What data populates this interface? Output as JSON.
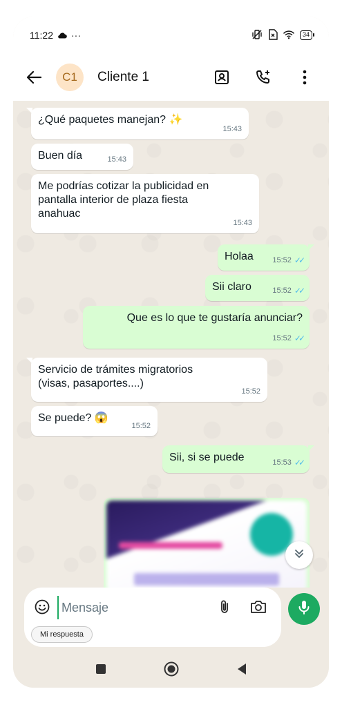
{
  "status_bar": {
    "time": "11:22",
    "notif_icon": "cloud-icon",
    "more_dots": "···",
    "battery": "34",
    "icons": [
      "vibrate-off-icon",
      "sim-x-icon",
      "wifi-icon",
      "battery-icon"
    ]
  },
  "header": {
    "avatar_initials": "C1",
    "contact_name": "Cliente 1",
    "icons": [
      "back-arrow-icon",
      "contact-card-icon",
      "add-call-icon",
      "more-vert-icon"
    ]
  },
  "messages": [
    {
      "dir": "in",
      "text": "¿Qué paquetes manejan? ✨",
      "time": "15:43"
    },
    {
      "dir": "in",
      "text": "Buen día",
      "time": "15:43"
    },
    {
      "dir": "in",
      "text": "Me podrías cotizar la publicidad en pantalla interior de plaza fiesta anahuac",
      "time": "15:43"
    },
    {
      "dir": "out",
      "text": "Holaa",
      "time": "15:52",
      "ticks": "✓✓"
    },
    {
      "dir": "out",
      "text": "Sii claro",
      "time": "15:52",
      "ticks": "✓✓"
    },
    {
      "dir": "out",
      "text": "Que es lo que te gustaría anunciar?",
      "time": "15:52",
      "ticks": "✓✓"
    },
    {
      "dir": "in",
      "text": "Servicio de trámites migratorios (visas, pasaportes....)",
      "time": "15:52"
    },
    {
      "dir": "in",
      "text": "Se puede? 😱",
      "time": "15:52"
    },
    {
      "dir": "out",
      "text": "Sii, si se puede",
      "time": "15:53",
      "ticks": "✓✓"
    }
  ],
  "composer": {
    "placeholder": "Mensaje",
    "quick_reply": "Mi respuesta"
  },
  "colors": {
    "chat_bg": "#efeae2",
    "outgoing": "#d9fdd3",
    "incoming": "#ffffff",
    "accent": "#1daa61",
    "read_ticks": "#53bdeb"
  }
}
